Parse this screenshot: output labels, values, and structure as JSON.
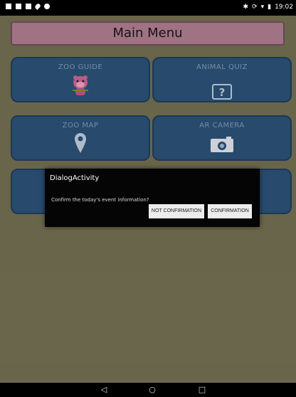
{
  "status_bar": {
    "time": "19:02",
    "left_icons": [
      "notification-icon",
      "image-icon",
      "sim-icon",
      "location-icon",
      "android-icon"
    ],
    "right_icons": [
      "bluetooth-icon",
      "sync-icon",
      "wifi-icon",
      "battery-icon"
    ]
  },
  "app": {
    "title": "Main Menu",
    "tiles": [
      {
        "label": "ZOO GUIDE",
        "icon": "mascot-icon"
      },
      {
        "label": "ANIMAL QUIZ",
        "icon": "question-icon"
      },
      {
        "label": "ZOO MAP",
        "icon": "map-pin-icon"
      },
      {
        "label": "AR CAMERA",
        "icon": "camera-icon"
      },
      {
        "label": "",
        "icon": ""
      },
      {
        "label": "",
        "icon": ""
      }
    ],
    "colors": {
      "background": "#6f6b4f",
      "tile": "#2a4f73",
      "header": "#a8798c"
    }
  },
  "dialog": {
    "title": "DialogActivity",
    "message": "Confirm the today's event information?",
    "negative_button": "NOT CONFIRMATION",
    "positive_button": "CONFIRMATION"
  },
  "nav_bar": {
    "icons": [
      "back-icon",
      "home-icon",
      "recents-icon"
    ]
  }
}
